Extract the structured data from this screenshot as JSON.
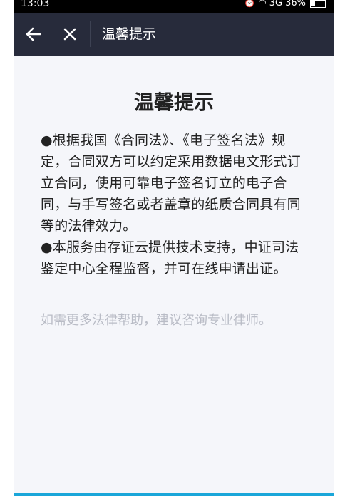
{
  "status_bar": {
    "time": "13:03",
    "network": "3G",
    "battery": "36%"
  },
  "nav": {
    "back_icon": "arrow-left-icon",
    "close_icon": "close-icon",
    "title": "温馨提示"
  },
  "content": {
    "heading": "温馨提示",
    "paragraph1": "●根据我国《合同法》、《电子签名法》规定，合同双方可以约定采用数据电文形式订立合同，使用可靠电子签名订立的电子合同，与手写签名或者盖章的纸质合同具有同等的法律效力。",
    "paragraph2": "●本服务由存证云提供技术支持，中证司法鉴定中心全程监督，并可在线申请出证。",
    "hint": "如需更多法律帮助，建议咨询专业律师。"
  },
  "colors": {
    "nav_bg": "#272b3b",
    "page_bg": "#f5f6fa",
    "hint_text": "#b9bcc6",
    "accent": "#1aa6d9"
  }
}
